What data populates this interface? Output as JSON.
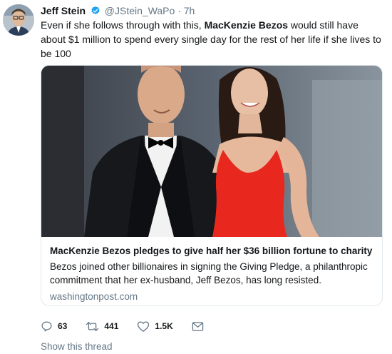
{
  "tweet": {
    "author_name": "Jeff Stein",
    "handle": "@JStein_WaPo",
    "separator": "·",
    "time": "7h",
    "text_part1": "Even if she follows through with this, ",
    "text_bold": "MacKenzie Bezos",
    "text_part2": " would still have about $1 million to spend every single day for the rest of her life if she lives to be 100"
  },
  "card": {
    "title": "MacKenzie Bezos pledges to give half her $36 billion fortune to charity",
    "description": "Bezos joined other billionaires in signing the Giving Pledge, a philanthropic commitment that her ex-husband, Jeff Bezos, has long resisted.",
    "domain": "washingtonpost.com"
  },
  "actions": {
    "reply_count": "63",
    "retweet_count": "441",
    "like_count": "1.5K"
  },
  "show_thread_label": "Show this thread",
  "icons": {
    "verified": "verified-badge-icon",
    "reply": "reply-icon",
    "retweet": "retweet-icon",
    "like": "heart-icon",
    "dm": "envelope-icon"
  },
  "colors": {
    "verified": "#1da1f2",
    "secondary_text": "#657786",
    "border": "#e1e8ed",
    "dress": "#e8281e"
  }
}
